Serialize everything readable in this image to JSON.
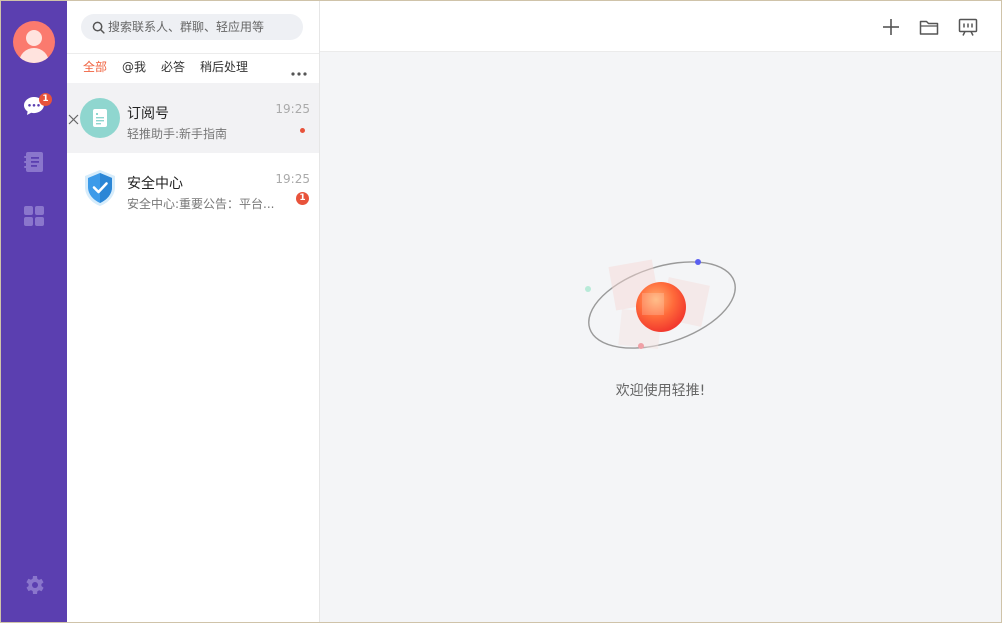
{
  "search": {
    "placeholder": "搜索联系人、群聊、轻应用等"
  },
  "rail": {
    "items": [
      {
        "name": "messages",
        "icon": "chat-bubble-icon",
        "badge": "1"
      },
      {
        "name": "docs",
        "icon": "notebook-icon"
      },
      {
        "name": "apps",
        "icon": "grid-apps-icon"
      }
    ],
    "settings_icon": "gear-icon"
  },
  "tabs": [
    "全部",
    "@我",
    "必答",
    "稍后处理"
  ],
  "conversations": [
    {
      "name": "订阅号",
      "preview": "轻推助手:新手指南",
      "time": "19:25",
      "unread": "dot"
    },
    {
      "name": "安全中心",
      "preview": "安全中心:重要公告：平台...",
      "time": "19:25",
      "badge": "1"
    }
  ],
  "toolbar": {
    "add_icon": "plus-icon",
    "folder_icon": "folder-icon",
    "present_icon": "presentation-icon"
  },
  "welcome": {
    "text": "欢迎使用轻推!"
  },
  "colors": {
    "rail": "#5b3fb0",
    "accent": "#f06340",
    "badge": "#e8533b"
  }
}
